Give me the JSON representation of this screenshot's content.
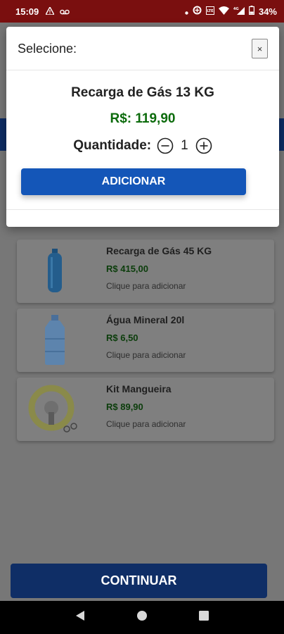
{
  "status_bar": {
    "time": "15:09",
    "battery": "34%",
    "network": "4G"
  },
  "modal": {
    "title": "Selecione:",
    "close_label": "×",
    "product_name": "Recarga de Gás 13 KG",
    "product_price": "R$: 119,90",
    "quantity_label": "Quantidade:",
    "quantity_value": "1",
    "add_label": "ADICIONAR"
  },
  "products": [
    {
      "name": "Recarga de Gás 45 KG",
      "price": "R$ 415,00",
      "hint": "Clique para adicionar",
      "icon": "gas-cylinder-icon"
    },
    {
      "name": "Água Mineral 20l",
      "price": "R$ 6,50",
      "hint": "Clique para adicionar",
      "icon": "water-gallon-icon"
    },
    {
      "name": "Kit Mangueira",
      "price": "R$ 89,90",
      "hint": "Clique para adicionar",
      "icon": "hose-kit-icon"
    }
  ],
  "continue_label": "CONTINUAR",
  "colors": {
    "status_bar": "#7a0f0f",
    "primary_button": "#1456b8",
    "price_green": "#0c6b0c"
  }
}
